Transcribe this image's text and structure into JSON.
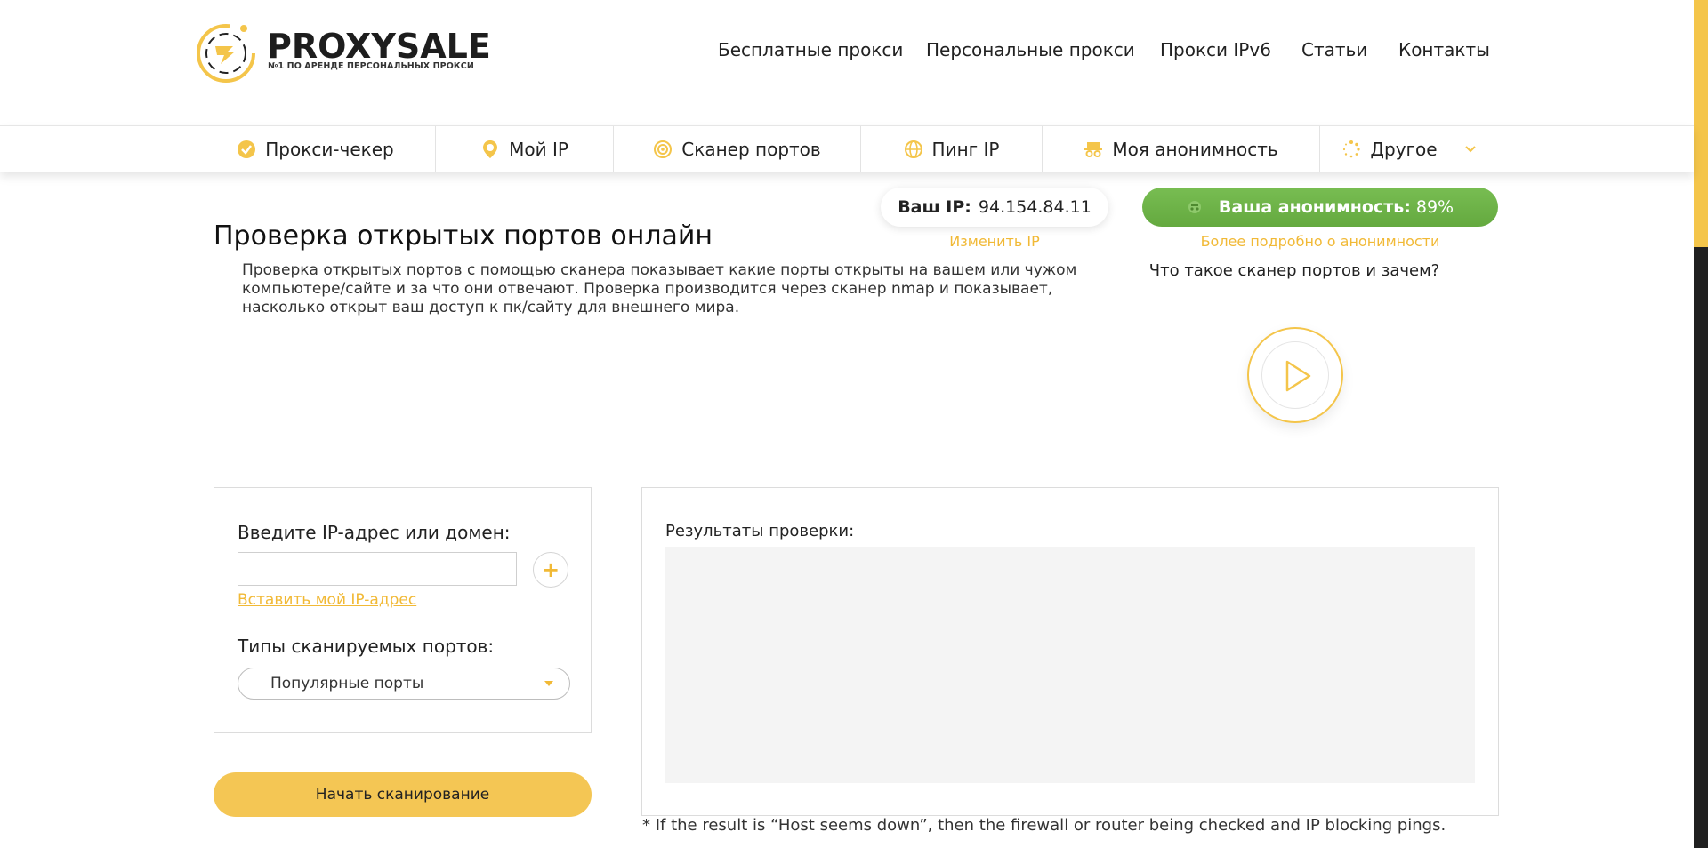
{
  "brand": {
    "name": "PROXYSALE",
    "tagline": "№1 ПО АРЕНДЕ ПЕРСОНАЛЬНЫХ ПРОКСИ",
    "accent_color": "#f4c54a",
    "green_color": "#6db147"
  },
  "top_nav": [
    {
      "label": "Бесплатные прокси"
    },
    {
      "label": "Персональные прокси"
    },
    {
      "label": "Прокси IPv6"
    },
    {
      "label": "Статьи"
    },
    {
      "label": "Контакты"
    }
  ],
  "tools_nav": [
    {
      "label": "Прокси-чекер",
      "icon": "check-circle-icon"
    },
    {
      "label": "Мой IP",
      "icon": "location-pin-icon"
    },
    {
      "label": "Сканер портов",
      "icon": "radar-icon"
    },
    {
      "label": "Пинг IP",
      "icon": "globe-icon"
    },
    {
      "label": "Моя анонимность",
      "icon": "incognito-icon"
    },
    {
      "label": "Другое",
      "icon": "loader-icon",
      "dropdown_icon": "chevron-down-icon"
    }
  ],
  "ip_widget": {
    "label": "Ваш IP:",
    "value": "94.154.84.11",
    "change_link": "Изменить IP"
  },
  "anonymity_widget": {
    "label": "Ваша анонимность:",
    "value": "89%",
    "more_link": "Более подробно о анонимности"
  },
  "main": {
    "title": "Проверка открытых портов онлайн",
    "description": "Проверка открытых портов с помощью сканера показывает какие порты открыты на вашем или чужом компьютере/сайте и за что они отвечают. Проверка производится через сканер nmap и показывает, насколько открыт ваш доступ к пк/сайту для внешнего мира.",
    "video_title": "Что такое сканер портов и зачем?"
  },
  "form": {
    "ip_label": "Введите IP-адрес или домен:",
    "ip_value": "",
    "add_button": "+",
    "insert_my_ip": "Вставить мой IP-адрес",
    "port_types_label": "Типы сканируемых портов:",
    "port_types_selected": "Популярные порты",
    "start_button": "Начать сканирование"
  },
  "results": {
    "title": "Результаты проверки:",
    "footnote": "* If the result is “Host seems down”, then the firewall or router being checked and IP blocking pings."
  }
}
